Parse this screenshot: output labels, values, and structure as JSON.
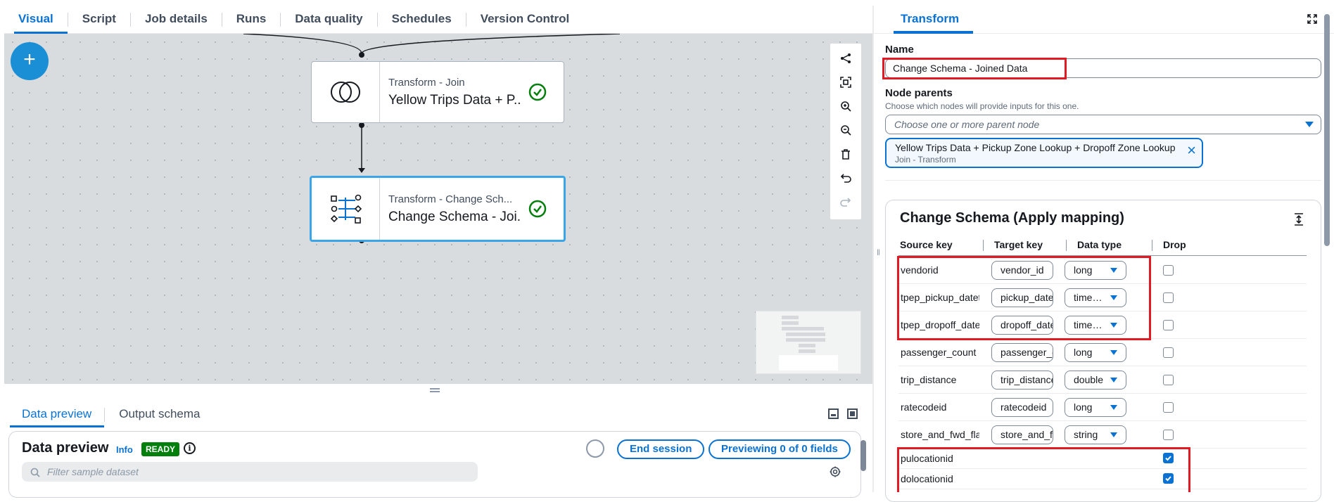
{
  "top_tabs": [
    "Visual",
    "Script",
    "Job details",
    "Runs",
    "Data quality",
    "Schedules",
    "Version Control"
  ],
  "canvas": {
    "add_label": "+",
    "nodes": [
      {
        "type": "Transform - Join",
        "title": "Yellow Trips Data + P..."
      },
      {
        "type": "Transform - Change Sch...",
        "title": "Change Schema - Joi..."
      }
    ]
  },
  "bottom": {
    "tabs": [
      "Data preview",
      "Output schema"
    ],
    "preview_title": "Data preview",
    "info_link": "Info",
    "status_badge": "READY",
    "info_symbol": "i",
    "end_session": "End session",
    "previewing": "Previewing 0 of 0 fields",
    "filter_placeholder": "Filter sample dataset"
  },
  "right_panel": {
    "tab": "Transform",
    "name_label": "Name",
    "name_value": "Change Schema - Joined Data",
    "parents_label": "Node parents",
    "parents_desc": "Choose which nodes will provide inputs for this one.",
    "parents_placeholder": "Choose one or more parent node",
    "token_main": "Yellow Trips Data + Pickup Zone Lookup + Dropoff Zone Lookup",
    "token_sub": "Join - Transform",
    "schema": {
      "title": "Change Schema (Apply mapping)",
      "headers": [
        "Source key",
        "Target key",
        "Data type",
        "Drop"
      ],
      "rows": [
        {
          "source": "vendorid",
          "target": "vendor_id",
          "type": "long",
          "drop": false
        },
        {
          "source": "tpep_pickup_datetime",
          "target": "pickup_datetime",
          "type": "timestamp",
          "drop": false
        },
        {
          "source": "tpep_dropoff_datetime",
          "target": "dropoff_datetime",
          "type": "timestamp",
          "drop": false
        },
        {
          "source": "passenger_count",
          "target": "passenger_count",
          "type": "long",
          "drop": false
        },
        {
          "source": "trip_distance",
          "target": "trip_distance",
          "type": "double",
          "drop": false
        },
        {
          "source": "ratecodeid",
          "target": "ratecodeid",
          "type": "long",
          "drop": false
        },
        {
          "source": "store_and_fwd_flag",
          "target": "store_and_fwd_flag",
          "type": "string",
          "drop": false
        },
        {
          "source": "pulocationid",
          "drop": true
        },
        {
          "source": "dolocationid",
          "drop": true
        }
      ]
    }
  },
  "colors": {
    "accent": "#0972d3",
    "success": "#037f0c",
    "highlight": "#e01b24"
  }
}
